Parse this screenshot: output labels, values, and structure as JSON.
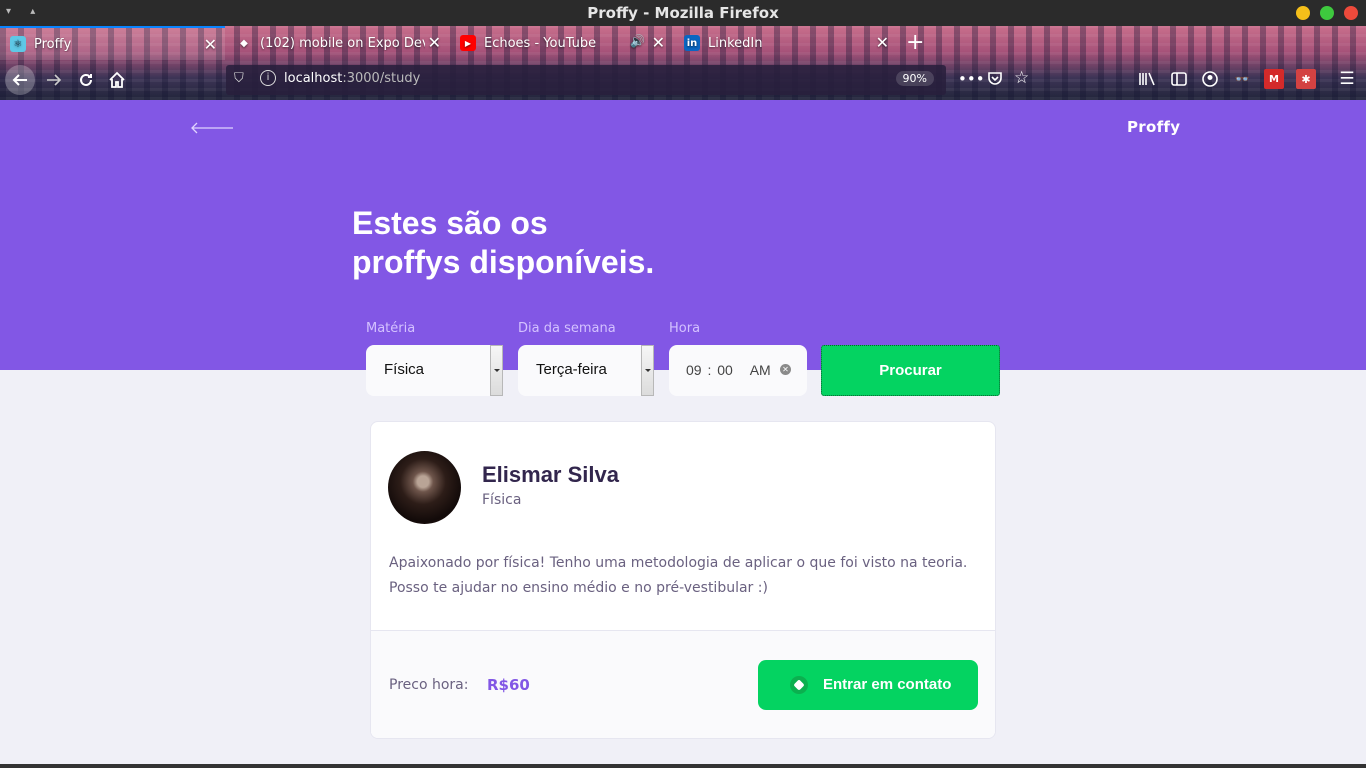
{
  "window": {
    "title": "Proffy - Mozilla Firefox"
  },
  "tabs": [
    {
      "label": "Proffy",
      "favicon": "react-icon",
      "active": true
    },
    {
      "label": "(102) mobile on Expo Deve",
      "favicon": "expo-icon",
      "active": false
    },
    {
      "label": "Echoes - YouTube",
      "favicon": "youtube-icon",
      "active": false,
      "playing_audio": true
    },
    {
      "label": "LinkedIn",
      "favicon": "linkedin-icon",
      "active": false
    }
  ],
  "url": {
    "host": "localhost",
    "path": ":3000/study",
    "zoom": "90%"
  },
  "app": {
    "logo": "Proffy",
    "headline_line1": "Estes são os",
    "headline_line2": "proffys disponíveis.",
    "filters": {
      "subject_label": "Matéria",
      "subject_value": "Física",
      "weekday_label": "Dia da semana",
      "weekday_value": "Terça-feira",
      "time_label": "Hora",
      "time_value": "09 : 00   AM",
      "search_label": "Procurar"
    },
    "teacher": {
      "name": "Elismar Silva",
      "subject": "Física",
      "bio": "Apaixonado por física! Tenho uma metodologia de aplicar o que foi visto na teoria. Posso te ajudar no ensino médio e no pré-vestibular :)",
      "price_label": "Preco hora:",
      "price_value": "R$60",
      "contact_label": "Entrar em contato"
    }
  },
  "colors": {
    "primary": "#8257e5",
    "secondary": "#04d361",
    "background": "#f0f0f7"
  }
}
